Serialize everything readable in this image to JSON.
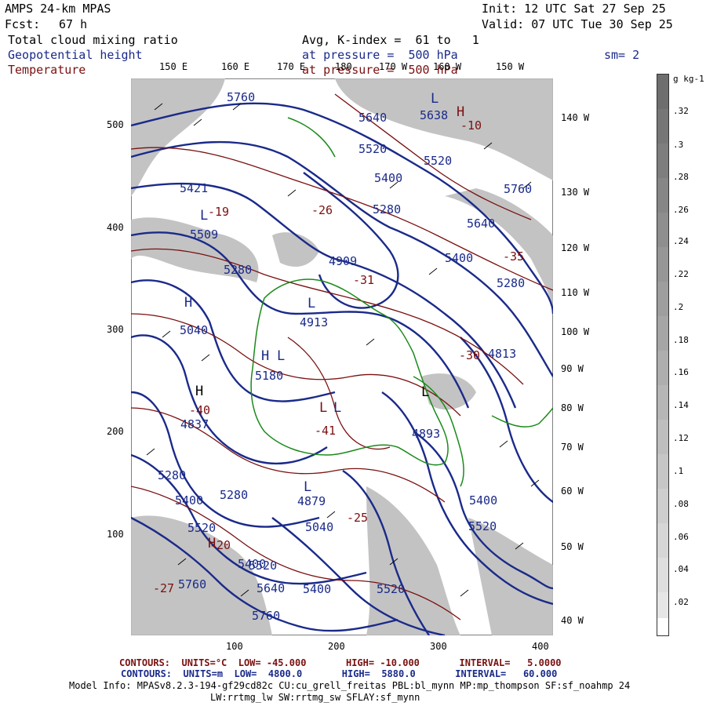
{
  "header": {
    "model": "AMPS 24-km MPAS",
    "fcst_label": "Fcst:",
    "fcst_value": "67 h",
    "init": "Init: 12 UTC Sat 27 Sep 25",
    "valid": "Valid: 07 UTC Tue 30 Sep 25",
    "var1": "Total cloud mixing ratio",
    "var2": "Geopotential height",
    "var3": "Temperature",
    "avg": "Avg, K-index =  61 to   1",
    "pres1": "at pressure =  500 hPa",
    "pres2": "at pressure =  500 hPa",
    "smooth": "sm= 2"
  },
  "colors": {
    "height_contours": "#1a2a8a",
    "temperature_contours": "#7a1010",
    "coastline": "#1a8a1a",
    "cloud_fill": "#bdbdbd"
  },
  "top_lon_ticks": [
    "150 E",
    "160 E",
    "170 E",
    "180",
    "170 W",
    "160 W",
    "150 W"
  ],
  "right_lon_ticks": [
    "140 W",
    "130 W",
    "120 W",
    "110 W",
    "100 W",
    "90 W",
    "80 W",
    "70 W",
    "60 W",
    "50 W",
    "40 W"
  ],
  "y_axis": [
    "500",
    "400",
    "300",
    "200",
    "100"
  ],
  "x_axis": [
    "100",
    "200",
    "300",
    "400"
  ],
  "colorbar": {
    "units": "g kg-1",
    "labels": [
      ".32",
      ".3",
      ".28",
      ".26",
      ".24",
      ".22",
      ".2",
      ".18",
      ".16",
      ".14",
      ".12",
      ".1",
      ".08",
      ".06",
      ".04",
      ".02"
    ]
  },
  "height_labels": [
    "5760",
    "5638",
    "5640",
    "5520",
    "5400",
    "5280",
    "5520",
    "5640",
    "5760",
    "5421",
    "5509",
    "5280",
    "5400",
    "5280",
    "4909",
    "5040",
    "4913",
    "5180",
    "4837",
    "4813",
    "5280",
    "5400",
    "5520",
    "5400",
    "5520",
    "5760",
    "5640",
    "5400",
    "5520",
    "4879",
    "5040",
    "4893",
    "5280",
    "5400",
    "5520",
    "5760"
  ],
  "temp_labels": [
    "-10",
    "-19",
    "-26",
    "-31",
    "-40",
    "-41",
    "-35",
    "-20",
    "-27",
    "-30",
    "-25"
  ],
  "highs_lows": [
    "H",
    "L",
    "L",
    "H",
    "L",
    "L",
    "H",
    "L",
    "L",
    "L",
    "H",
    "L",
    "H"
  ],
  "footer": {
    "line1": "CONTOURS:  UNITS=°C  LOW= -45.000       HIGH= -10.000       INTERVAL=   5.0000",
    "line2": "CONTOURS:  UNITS=m  LOW=  4800.0       HIGH=  5880.0       INTERVAL=   60.000",
    "line3": "Model Info: MPASv8.2.3-194-gf29cd82c CU:cu_grell_freitas PBL:bl_mynn MP:mp_thompson SF:sf_noahmp 24",
    "line4": "LW:rrtmg_lw SW:rrtmg_sw SFLAY:sf_mynn"
  }
}
